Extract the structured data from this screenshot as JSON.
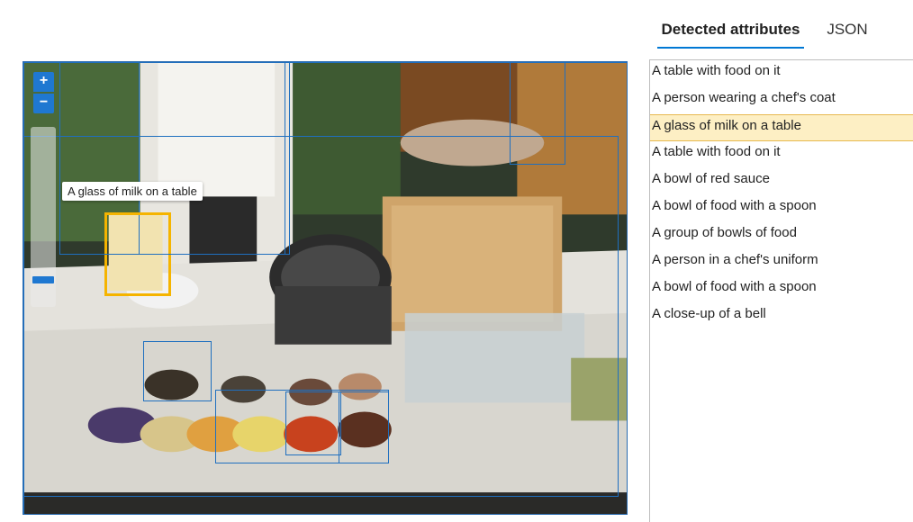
{
  "tabs": [
    {
      "label": "Detected attributes",
      "active": true
    },
    {
      "label": "JSON",
      "active": false
    }
  ],
  "viewer": {
    "zoom_in_label": "+",
    "zoom_out_label": "−",
    "zoom_level": 0.1,
    "tooltip": "A glass of milk on a table",
    "active_box_color": "#f5b400",
    "box_color": "#1f6fbf"
  },
  "attributes": [
    {
      "label": "A table with food on it",
      "selected": false
    },
    {
      "label": "A person wearing a chef's coat",
      "selected": false
    },
    {
      "label": "A glass of milk on a table",
      "selected": true
    },
    {
      "label": "A table with food on it",
      "selected": false
    },
    {
      "label": "A bowl of red sauce",
      "selected": false
    },
    {
      "label": "A bowl of food with a spoon",
      "selected": false
    },
    {
      "label": "A group of bowls of food",
      "selected": false
    },
    {
      "label": "A person in a chef's uniform",
      "selected": false
    },
    {
      "label": "A bowl of food with a spoon",
      "selected": false
    },
    {
      "label": "A close-up of a bell",
      "selected": false
    }
  ]
}
